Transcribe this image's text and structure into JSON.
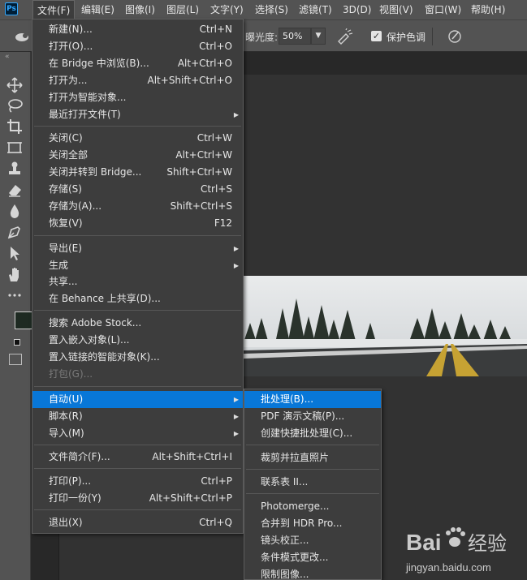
{
  "app": {
    "logo_text": "Ps"
  },
  "menubar": {
    "items": [
      {
        "label": "文件(F)",
        "active": true
      },
      {
        "label": "编辑(E)"
      },
      {
        "label": "图像(I)"
      },
      {
        "label": "图层(L)"
      },
      {
        "label": "文字(Y)"
      },
      {
        "label": "选择(S)"
      },
      {
        "label": "滤镜(T)"
      },
      {
        "label": "3D(D)"
      },
      {
        "label": "视图(V)"
      },
      {
        "label": "窗口(W)"
      },
      {
        "label": "帮助(H)"
      }
    ]
  },
  "options": {
    "exposure_label": "曝光度:",
    "exposure_value": "50%",
    "protect_tones_label": "保护色调",
    "protect_tones_checked": true
  },
  "file_menu": {
    "items": [
      {
        "label": "新建(N)...",
        "shortcut": "Ctrl+N"
      },
      {
        "label": "打开(O)...",
        "shortcut": "Ctrl+O"
      },
      {
        "label": "在 Bridge 中浏览(B)...",
        "shortcut": "Alt+Ctrl+O"
      },
      {
        "label": "打开为...",
        "shortcut": "Alt+Shift+Ctrl+O"
      },
      {
        "label": "打开为智能对象..."
      },
      {
        "label": "最近打开文件(T)",
        "submenu": true
      },
      {
        "separator": true
      },
      {
        "label": "关闭(C)",
        "shortcut": "Ctrl+W"
      },
      {
        "label": "关闭全部",
        "shortcut": "Alt+Ctrl+W"
      },
      {
        "label": "关闭并转到 Bridge...",
        "shortcut": "Shift+Ctrl+W"
      },
      {
        "label": "存储(S)",
        "shortcut": "Ctrl+S"
      },
      {
        "label": "存储为(A)...",
        "shortcut": "Shift+Ctrl+S"
      },
      {
        "label": "恢复(V)",
        "shortcut": "F12"
      },
      {
        "separator": true
      },
      {
        "label": "导出(E)",
        "submenu": true
      },
      {
        "label": "生成",
        "submenu": true
      },
      {
        "label": "共享..."
      },
      {
        "label": "在 Behance 上共享(D)..."
      },
      {
        "separator": true
      },
      {
        "label": "搜索 Adobe Stock..."
      },
      {
        "label": "置入嵌入对象(L)..."
      },
      {
        "label": "置入链接的智能对象(K)..."
      },
      {
        "label": "打包(G)...",
        "disabled": true
      },
      {
        "separator": true
      },
      {
        "label": "自动(U)",
        "submenu": true,
        "highlighted": true
      },
      {
        "label": "脚本(R)",
        "submenu": true
      },
      {
        "label": "导入(M)",
        "submenu": true
      },
      {
        "separator": true
      },
      {
        "label": "文件简介(F)...",
        "shortcut": "Alt+Shift+Ctrl+I"
      },
      {
        "separator": true
      },
      {
        "label": "打印(P)...",
        "shortcut": "Ctrl+P"
      },
      {
        "label": "打印一份(Y)",
        "shortcut": "Alt+Shift+Ctrl+P"
      },
      {
        "separator": true
      },
      {
        "label": "退出(X)",
        "shortcut": "Ctrl+Q"
      }
    ]
  },
  "automate_menu": {
    "items": [
      {
        "label": "批处理(B)...",
        "highlighted": true
      },
      {
        "label": "PDF 演示文稿(P)..."
      },
      {
        "label": "创建快捷批处理(C)..."
      },
      {
        "separator": true
      },
      {
        "label": "裁剪并拉直照片"
      },
      {
        "separator": true
      },
      {
        "label": "联系表 II..."
      },
      {
        "separator": true
      },
      {
        "label": "Photomerge..."
      },
      {
        "label": "合并到 HDR Pro..."
      },
      {
        "label": "镜头校正..."
      },
      {
        "label": "条件模式更改..."
      },
      {
        "label": "限制图像..."
      }
    ]
  },
  "tools": [
    {
      "name": "move-tool-icon"
    },
    {
      "name": "lasso-tool-icon"
    },
    {
      "name": "crop-tool-icon"
    },
    {
      "name": "frame-tool-icon"
    },
    {
      "name": "stamp-tool-icon"
    },
    {
      "name": "eraser-tool-icon"
    },
    {
      "name": "blur-tool-icon"
    },
    {
      "name": "pen-tool-icon"
    },
    {
      "name": "path-select-tool-icon"
    },
    {
      "name": "hand-tool-icon"
    },
    {
      "name": "more-tools-icon"
    }
  ],
  "colors": {
    "highlight": "#0877d8",
    "menu_bg": "#3d3d3d",
    "foreground_swatch": "#1e2a22"
  },
  "watermark": {
    "brand": "Bai",
    "brand2": "经验",
    "url": "jingyan.baidu.com"
  }
}
